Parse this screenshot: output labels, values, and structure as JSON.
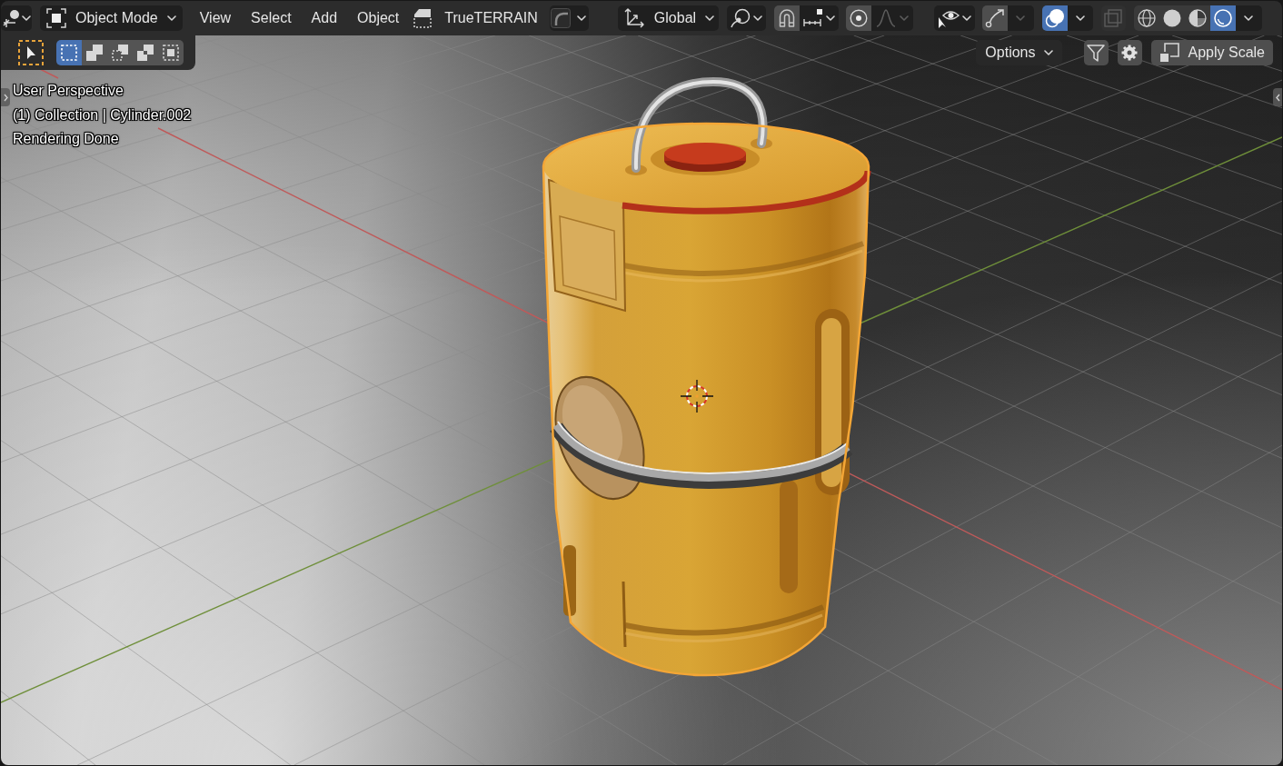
{
  "header": {
    "mode_dropdown": {
      "label": "Object Mode"
    },
    "menus": [
      {
        "label": "View"
      },
      {
        "label": "Select"
      },
      {
        "label": "Add"
      },
      {
        "label": "Object"
      }
    ],
    "addon": {
      "label": "TrueTERRAIN"
    },
    "orientation_dropdown": {
      "label": "Global"
    },
    "snap": {
      "on": true
    },
    "proportional_editing": {
      "on": true,
      "falloff_disabled": true
    },
    "gizmos": {
      "on": true,
      "menu_disabled": true
    },
    "overlays": {
      "on": true
    },
    "xray": {
      "disabled": true
    },
    "shading_modes": [
      {
        "kind": "wireframe",
        "selected": false
      },
      {
        "kind": "solid",
        "selected": false
      },
      {
        "kind": "material",
        "selected": false
      },
      {
        "kind": "rendered",
        "selected": true
      }
    ]
  },
  "tool_header": {
    "active_tool": {
      "selected": true
    },
    "select_modes": [
      {
        "kind": "set",
        "selected": true
      },
      {
        "kind": "extend",
        "selected": false
      },
      {
        "kind": "subtract",
        "selected": false
      },
      {
        "kind": "invert",
        "selected": false
      },
      {
        "kind": "intersect",
        "selected": false
      }
    ],
    "options_dropdown": {
      "label": "Options"
    },
    "apply_scale_button": {
      "label": "Apply Scale"
    }
  },
  "viewport": {
    "info": [
      "User Perspective",
      "(1) Collection | Cylinder.002",
      "Rendering Done"
    ],
    "object_selected": true
  }
}
